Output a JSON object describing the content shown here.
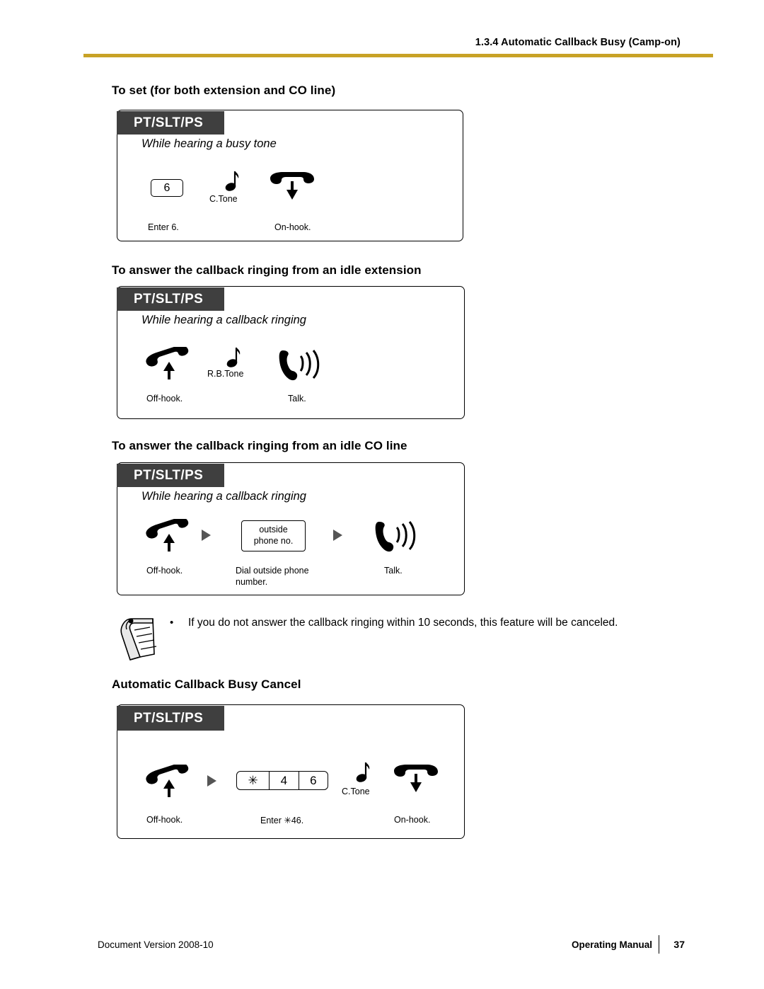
{
  "header": {
    "section_ref": "1.3.4 Automatic Callback Busy (Camp-on)",
    "accent_color": "#c8a226"
  },
  "sections": [
    {
      "heading": "To set (for both extension and CO line)",
      "tab_label": "PT/SLT/PS",
      "condition": "While hearing a busy tone",
      "steps": [
        {
          "key": "6",
          "caption": "Enter 6."
        },
        {
          "icon": "music-note-icon",
          "label": "C.Tone"
        },
        {
          "icon": "handset-onhook-icon",
          "caption": "On-hook."
        }
      ]
    },
    {
      "heading": "To answer the callback ringing from an idle extension",
      "tab_label": "PT/SLT/PS",
      "condition": "While hearing a callback ringing",
      "steps": [
        {
          "icon": "handset-offhook-icon",
          "caption": "Off-hook."
        },
        {
          "icon": "music-note-icon",
          "label": "R.B.Tone"
        },
        {
          "icon": "handset-talk-icon",
          "caption": "Talk."
        }
      ]
    },
    {
      "heading": "To answer the callback ringing from an idle CO line",
      "tab_label": "PT/SLT/PS",
      "condition": "While hearing a callback ringing",
      "steps": [
        {
          "icon": "handset-offhook-icon",
          "caption": "Off-hook."
        },
        {
          "icon": "arrow-right-icon"
        },
        {
          "box_line1": "outside",
          "box_line2": "phone no.",
          "caption": "Dial outside phone number."
        },
        {
          "icon": "arrow-right-icon"
        },
        {
          "icon": "handset-talk-icon",
          "caption": "Talk."
        }
      ]
    }
  ],
  "note": {
    "icon": "note-pad-icon",
    "bullet": "•",
    "text": "If you do not answer the callback ringing within 10 seconds, this feature will be canceled."
  },
  "cancel_section": {
    "heading": "Automatic Callback Busy Cancel",
    "tab_label": "PT/SLT/PS",
    "steps": [
      {
        "icon": "handset-offhook-icon",
        "caption": "Off-hook."
      },
      {
        "icon": "arrow-right-icon"
      },
      {
        "keys": [
          "✳",
          "4",
          "6"
        ],
        "caption": "Enter ✳46."
      },
      {
        "icon": "music-note-icon",
        "label": "C.Tone"
      },
      {
        "icon": "handset-onhook-icon",
        "caption": "On-hook."
      }
    ]
  },
  "footer": {
    "document_version": "Document Version  2008-10",
    "manual_title": "Operating Manual",
    "page_number": "37"
  }
}
